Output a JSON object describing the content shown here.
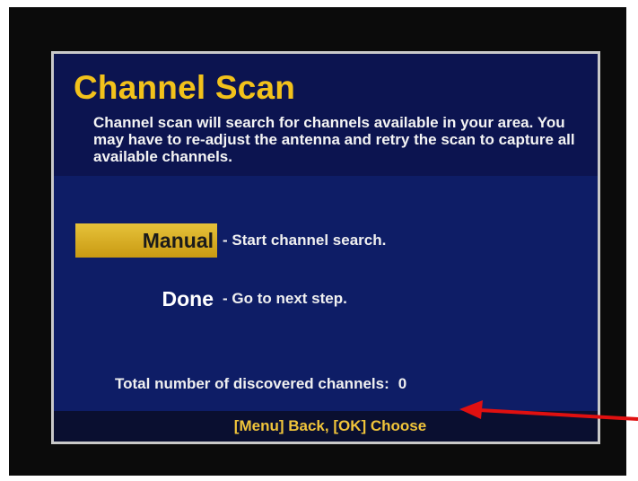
{
  "screen": {
    "title": "Channel Scan",
    "description": "Channel scan will search for channels available in your area. You may have to re-adjust the antenna and retry the scan to capture all available channels.",
    "options": [
      {
        "label": "Manual",
        "description": "- Start channel search.",
        "selected": true
      },
      {
        "label": "Done",
        "description": "- Go to next step.",
        "selected": false
      }
    ],
    "channel_count": {
      "label": "Total number of discovered channels:",
      "value": "0"
    },
    "footer_hint": "[Menu] Back, [OK] Choose"
  },
  "colors": {
    "title": "#f2c21b",
    "panel_bg": "#0d1a5c",
    "highlight": "#e0b62c",
    "annotation_arrow": "#e01010"
  },
  "annotation": {
    "icon": "red-arrow-icon"
  }
}
